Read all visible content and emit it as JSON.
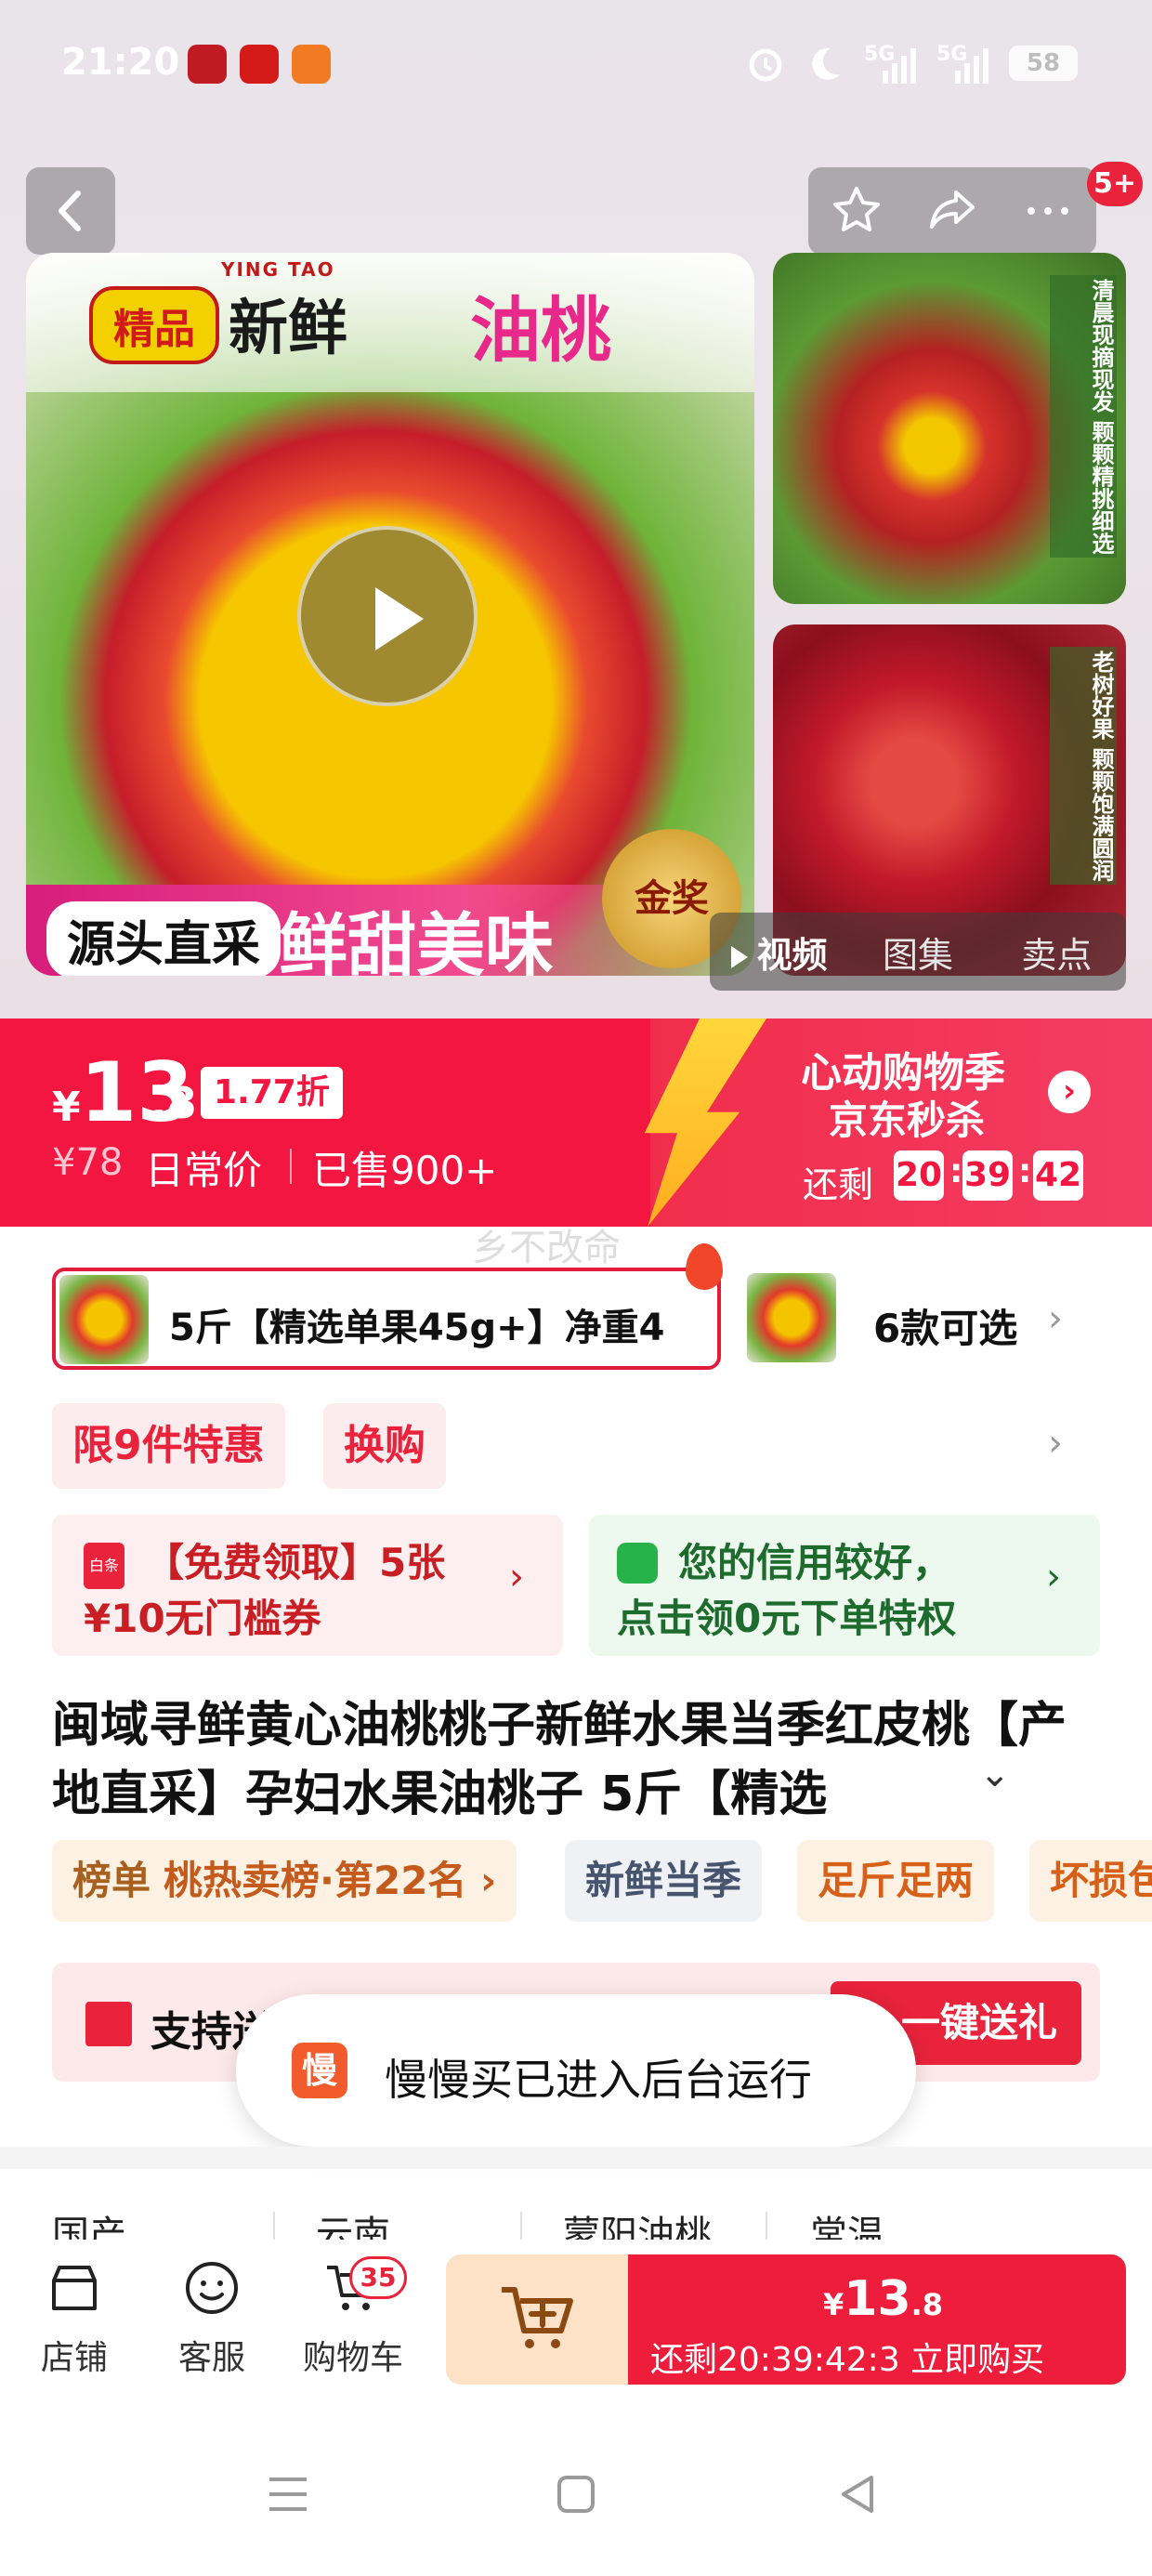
{
  "status_bar": {
    "time": "21:20",
    "network_1": "5G",
    "network_2": "5G",
    "battery": "58"
  },
  "nav": {
    "badge": "5+"
  },
  "gallery": {
    "main_badge": "精品",
    "main_title": "新鲜",
    "main_title_accent": "油桃",
    "main_pinyin": "YING TAO",
    "main_tag": "源头直采",
    "main_slogan": "鲜甜美味",
    "medal": "金奖",
    "side_1_text": "清晨现摘现发 颗颗精挑细选",
    "side_2_text": "老树好果 颗颗饱满圆润",
    "tabs": [
      "视频",
      "图集",
      "卖点"
    ]
  },
  "price": {
    "currency": "¥",
    "integer": "13",
    "decimal": ".8",
    "discount": "1.77折",
    "original": "¥78",
    "original_label": "日常价",
    "sold": "已售900+",
    "promo_title": "心动购物季",
    "promo_sub": "京东秒杀",
    "remain_label": "还剩",
    "countdown": [
      "20",
      "39",
      "42"
    ]
  },
  "watermark": "乡不改命",
  "sku": {
    "selected": "5斤【精选单果45g+】净重4",
    "more": "6款可选"
  },
  "tags": {
    "limit": "限9件特惠",
    "exchange": "换购"
  },
  "coupons": {
    "left_icon": "白条",
    "left_line1": "【免费领取】5张",
    "left_line2": "¥10无门槛券",
    "right_line1": "您的信用较好，",
    "right_line2": "点击领0元下单特权"
  },
  "product": {
    "title": "闽域寻鲜黄心油桃桃子新鲜水果当季红皮桃【产地直采】孕妇水果油桃子 5斤【精选"
  },
  "chips": {
    "rank_label": "榜单",
    "rank_value": "桃热卖榜·第22名",
    "fresh": "新鲜当季",
    "jin": "足斤足两",
    "bad": "坏损包"
  },
  "gift": {
    "text": "支持送",
    "button": "一键送礼"
  },
  "toast": {
    "icon": "慢",
    "text": "慢慢买已进入后台运行"
  },
  "params": [
    "国产",
    "云南",
    "蒙阳油桃",
    "常温"
  ],
  "bottom_bar": {
    "shop": "店铺",
    "service": "客服",
    "cart": "购物车",
    "cart_count": "35",
    "buy_currency": "¥",
    "buy_price": "13",
    "buy_decimal": ".8",
    "buy_sub": "还剩20:39:42:3 立即购买"
  },
  "icons": {
    "back": "chevron-left-icon",
    "favorite": "star-icon",
    "share": "share-icon",
    "more": "more-dots-icon",
    "play": "play-icon",
    "shop": "shop-icon",
    "service": "smile-icon",
    "cart": "cart-icon",
    "add_cart": "cart-plus-icon"
  },
  "colors": {
    "accent": "#f21640",
    "buy_button": "#ee1d3c",
    "add_cart_bg": "#fde2c8"
  }
}
